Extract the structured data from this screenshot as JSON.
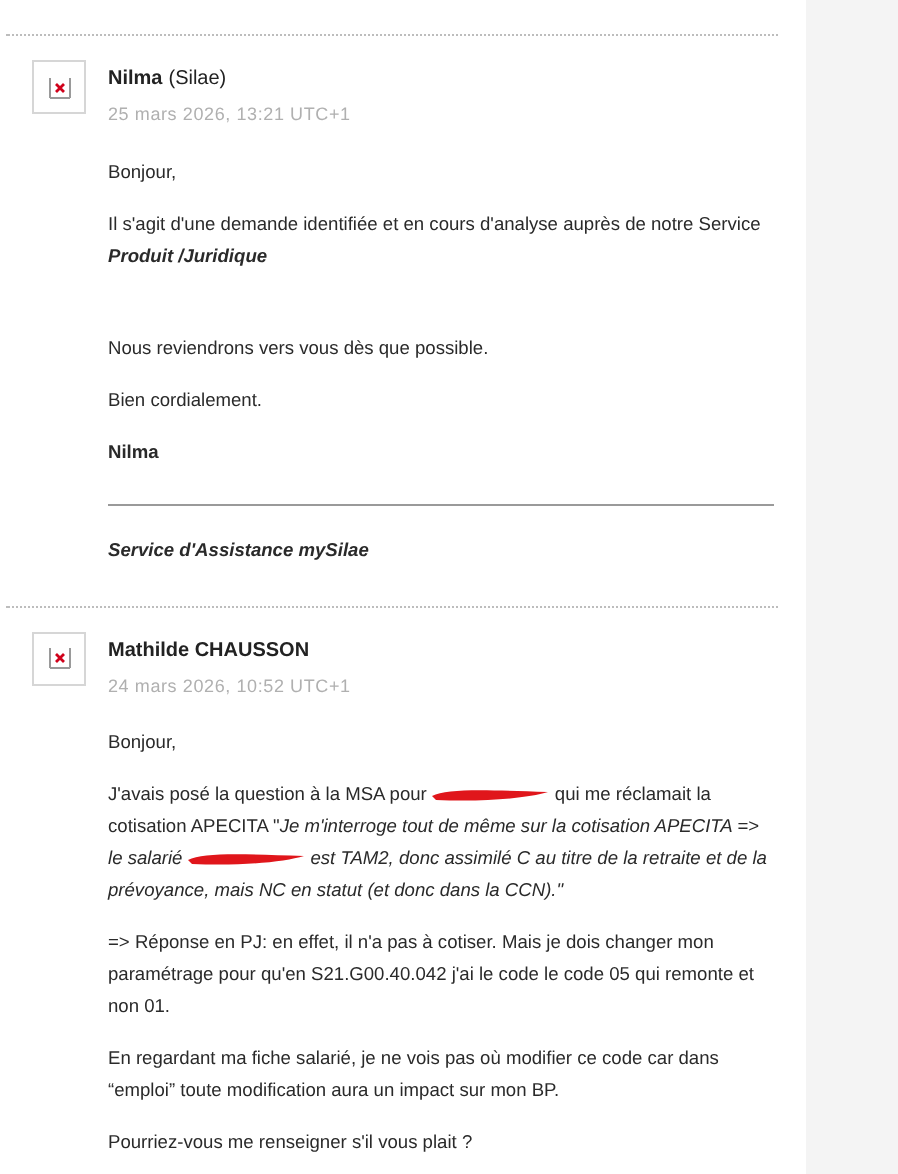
{
  "messages": [
    {
      "author": "Nilma",
      "affiliation": "(Silae)",
      "date": "25 mars 2026, 13:21 UTC+1",
      "paragraphs": [
        {
          "kind": "text",
          "parts": [
            {
              "kind": "text",
              "text": "Bonjour,"
            }
          ]
        },
        {
          "kind": "text",
          "parts": [
            {
              "kind": "text",
              "text": "Il s'agit d'une demande identifiée et en cours d'analyse auprès de notre Service "
            },
            {
              "kind": "emphasis",
              "text": "Produit /Juridique"
            }
          ]
        },
        {
          "kind": "blank"
        },
        {
          "kind": "text",
          "parts": [
            {
              "kind": "text",
              "text": "Nous reviendrons vers vous dès que possible."
            }
          ]
        },
        {
          "kind": "text",
          "parts": [
            {
              "kind": "text",
              "text": "Bien cordialement."
            }
          ]
        },
        {
          "kind": "bold",
          "parts": [
            {
              "kind": "text",
              "text": "Nilma"
            }
          ]
        },
        {
          "kind": "rule"
        },
        {
          "kind": "signature",
          "parts": [
            {
              "kind": "text",
              "text": "Service d'Assistance mySilae"
            }
          ]
        }
      ]
    },
    {
      "author": "Mathilde CHAUSSON",
      "date": "24 mars 2026, 10:52 UTC+1",
      "paragraphs": [
        {
          "kind": "text",
          "parts": [
            {
              "kind": "text",
              "text": "Bonjour,"
            }
          ]
        },
        {
          "kind": "text",
          "parts": [
            {
              "kind": "text",
              "text": "J'avais posé la question à la MSA pour"
            },
            {
              "kind": "redaction"
            },
            {
              "kind": "text",
              "text": "qui me réclamait la cotisation APECITA \"*Je m'interroge tout de même sur la cotisation APECITA => le salarié*"
            },
            {
              "kind": "redaction"
            },
            {
              "kind": "text",
              "text": "*est TAM2, donc assimilé C au titre de la retraite et de la prévoyance, mais NC en statut (et donc dans la CCN).\"*"
            }
          ]
        },
        {
          "kind": "text",
          "parts": [
            {
              "kind": "text",
              "text": "=> Réponse en PJ: en effet, il n'a pas à cotiser. Mais je dois changer mon paramétrage pour qu'en S21.G00.40.042 j'ai le code le code 05 qui remonte et non 01."
            }
          ]
        },
        {
          "kind": "text",
          "parts": [
            {
              "kind": "text",
              "text": "En regardant ma fiche salarié, je ne vois pas où modifier ce code car dans “emploi” toute modification aura un impact sur mon BP."
            }
          ]
        },
        {
          "kind": "text",
          "parts": [
            {
              "kind": "text",
              "text": "Pourriez-vous me renseigner s'il vous plait ?"
            }
          ]
        }
      ]
    }
  ]
}
